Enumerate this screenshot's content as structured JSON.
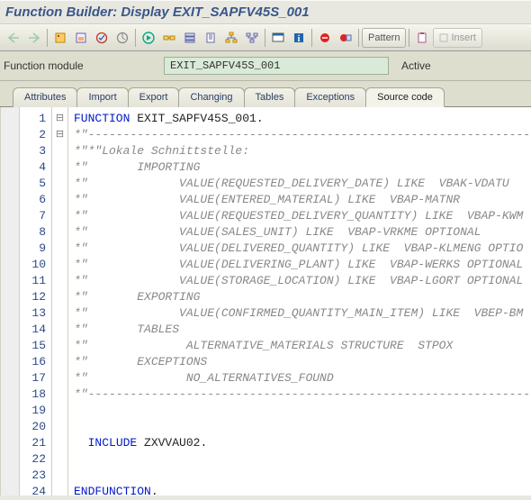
{
  "title": "Function Builder: Display EXIT_SAPFV45S_001",
  "toolbar": {
    "pattern": "Pattern",
    "insert": "Insert"
  },
  "form": {
    "module_label": "Function module",
    "module_value": "EXIT_SAPFV45S_001",
    "status": "Active"
  },
  "tabs": {
    "attributes": "Attributes",
    "import": "Import",
    "export": "Export",
    "changing": "Changing",
    "tables": "Tables",
    "exceptions": "Exceptions",
    "source": "Source code"
  },
  "code": {
    "lines": [
      {
        "n": 1,
        "fold": "⊟",
        "seg": [
          {
            "c": "kw-blue",
            "t": "FUNCTION "
          },
          {
            "c": "",
            "t": "EXIT_SAPFV45S_001."
          }
        ]
      },
      {
        "n": 2,
        "fold": "⊟",
        "seg": [
          {
            "c": "cm-gray",
            "t": "*\"----------------------------------------------------------------------"
          }
        ]
      },
      {
        "n": 3,
        "fold": "",
        "seg": [
          {
            "c": "cm-gray",
            "t": "*\"*\"Lokale Schnittstelle:"
          }
        ]
      },
      {
        "n": 4,
        "fold": "",
        "seg": [
          {
            "c": "cm-gray",
            "t": "*\"       IMPORTING"
          }
        ]
      },
      {
        "n": 5,
        "fold": "",
        "seg": [
          {
            "c": "cm-gray",
            "t": "*\"             VALUE(REQUESTED_DELIVERY_DATE) LIKE  VBAK-VDATU"
          }
        ]
      },
      {
        "n": 6,
        "fold": "",
        "seg": [
          {
            "c": "cm-gray",
            "t": "*\"             VALUE(ENTERED_MATERIAL) LIKE  VBAP-MATNR"
          }
        ]
      },
      {
        "n": 7,
        "fold": "",
        "seg": [
          {
            "c": "cm-gray",
            "t": "*\"             VALUE(REQUESTED_DELIVERY_QUANTITY) LIKE  VBAP-KWM"
          }
        ]
      },
      {
        "n": 8,
        "fold": "",
        "seg": [
          {
            "c": "cm-gray",
            "t": "*\"             VALUE(SALES_UNIT) LIKE  VBAP-VRKME OPTIONAL"
          }
        ]
      },
      {
        "n": 9,
        "fold": "",
        "seg": [
          {
            "c": "cm-gray",
            "t": "*\"             VALUE(DELIVERED_QUANTITY) LIKE  VBAP-KLMENG OPTIO"
          }
        ]
      },
      {
        "n": 10,
        "fold": "",
        "seg": [
          {
            "c": "cm-gray",
            "t": "*\"             VALUE(DELIVERING_PLANT) LIKE  VBAP-WERKS OPTIONAL"
          }
        ]
      },
      {
        "n": 11,
        "fold": "",
        "seg": [
          {
            "c": "cm-gray",
            "t": "*\"             VALUE(STORAGE_LOCATION) LIKE  VBAP-LGORT OPTIONAL"
          }
        ]
      },
      {
        "n": 12,
        "fold": "",
        "seg": [
          {
            "c": "cm-gray",
            "t": "*\"       EXPORTING"
          }
        ]
      },
      {
        "n": 13,
        "fold": "",
        "seg": [
          {
            "c": "cm-gray",
            "t": "*\"             VALUE(CONFIRMED_QUANTITY_MAIN_ITEM) LIKE  VBEP-BM"
          }
        ]
      },
      {
        "n": 14,
        "fold": "",
        "seg": [
          {
            "c": "cm-gray",
            "t": "*\"       TABLES"
          }
        ]
      },
      {
        "n": 15,
        "fold": "",
        "seg": [
          {
            "c": "cm-gray",
            "t": "*\"              ALTERNATIVE_MATERIALS STRUCTURE  STPOX"
          }
        ]
      },
      {
        "n": 16,
        "fold": "",
        "seg": [
          {
            "c": "cm-gray",
            "t": "*\"       EXCEPTIONS"
          }
        ]
      },
      {
        "n": 17,
        "fold": "",
        "seg": [
          {
            "c": "cm-gray",
            "t": "*\"              NO_ALTERNATIVES_FOUND"
          }
        ]
      },
      {
        "n": 18,
        "fold": "",
        "seg": [
          {
            "c": "cm-gray",
            "t": "*\"----------------------------------------------------------------------"
          }
        ]
      },
      {
        "n": 19,
        "fold": "",
        "seg": [
          {
            "c": "",
            "t": ""
          }
        ]
      },
      {
        "n": 20,
        "fold": "",
        "seg": [
          {
            "c": "",
            "t": ""
          }
        ]
      },
      {
        "n": 21,
        "fold": "",
        "seg": [
          {
            "c": "",
            "t": "  "
          },
          {
            "c": "kw-blue",
            "t": "INCLUDE "
          },
          {
            "c": "",
            "t": "ZXVVAU02."
          }
        ]
      },
      {
        "n": 22,
        "fold": "",
        "seg": [
          {
            "c": "",
            "t": ""
          }
        ]
      },
      {
        "n": 23,
        "fold": "",
        "seg": [
          {
            "c": "",
            "t": ""
          }
        ]
      },
      {
        "n": 24,
        "fold": "",
        "seg": [
          {
            "c": "kw-blue",
            "t": "ENDFUNCTION"
          },
          {
            "c": "",
            "t": "."
          }
        ]
      }
    ]
  }
}
